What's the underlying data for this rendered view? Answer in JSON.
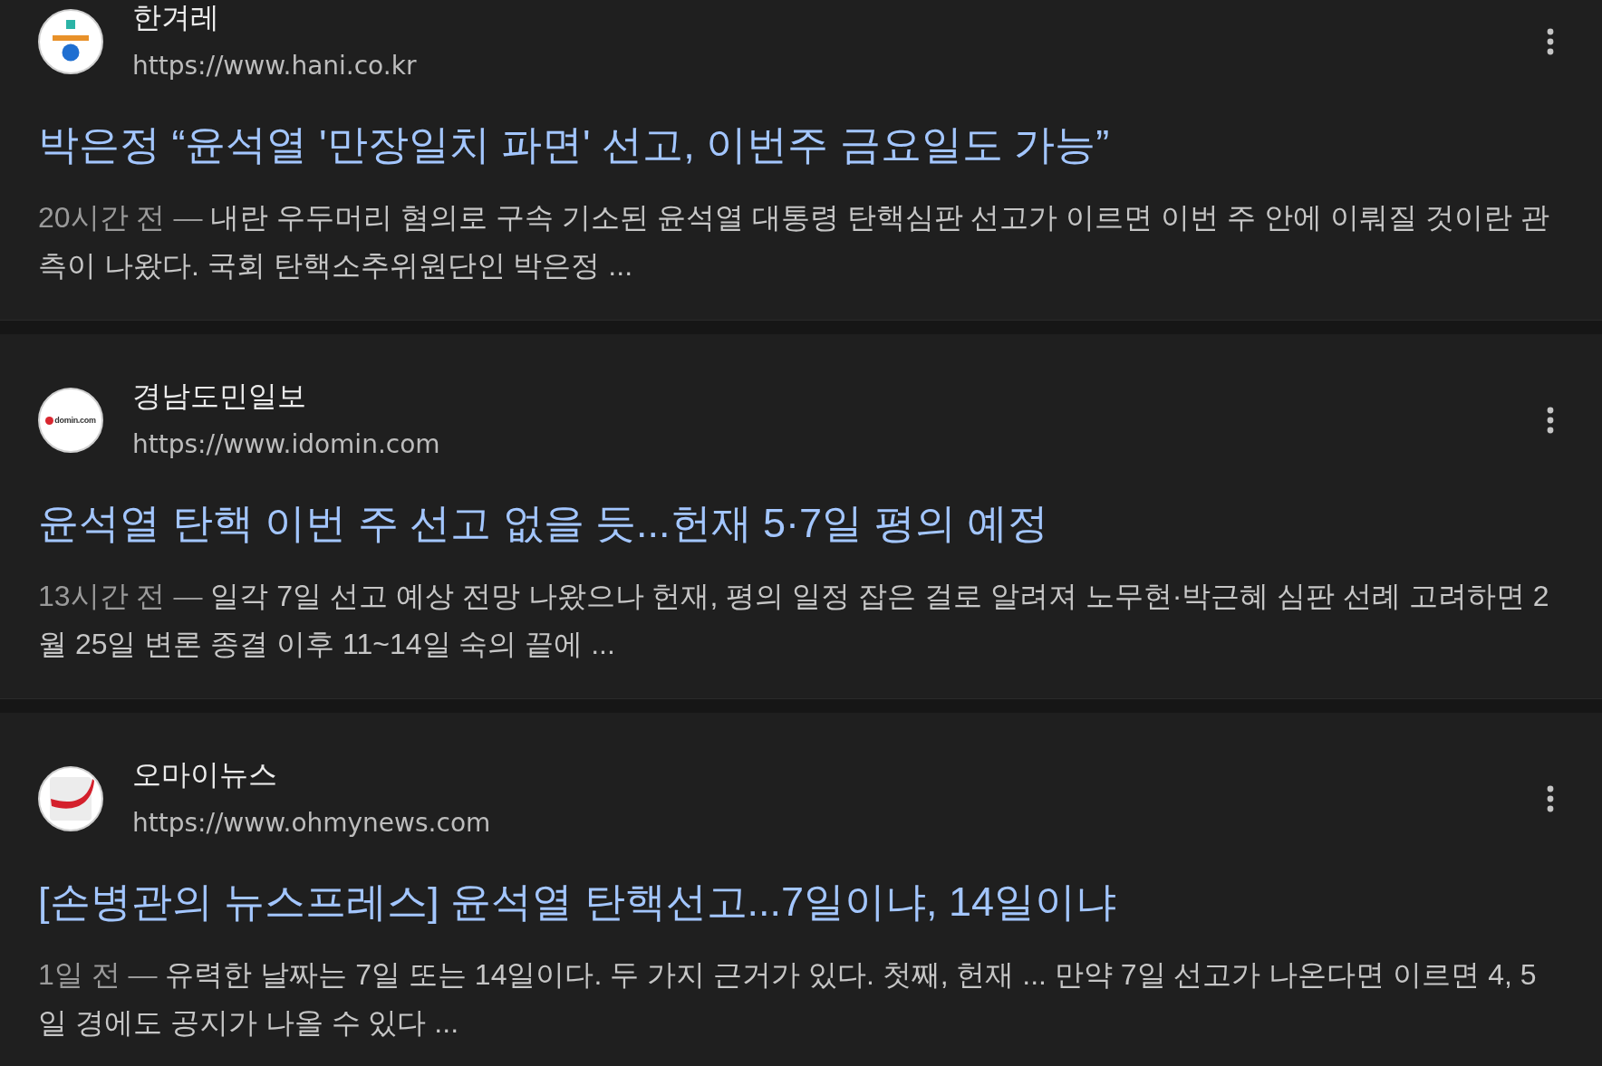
{
  "results": [
    {
      "logo": {
        "kind": "bar-dot"
      },
      "source": "한겨레",
      "url": "https://www.hani.co.kr",
      "title": "박은정 “윤석열 '만장일치 파면' 선고, 이번주 금요일도 가능”",
      "date": "20시간 전 —",
      "snippet": "내란 우두머리 혐의로 구속 기소된 윤석열 대통령 탄핵심판 선고가 이르면 이번 주 안에 이뤄질 것이란 관측이 나왔다. 국회 탄핵소추위원단인 박은정 ..."
    },
    {
      "logo": {
        "kind": "wordmark",
        "text": "domin.com"
      },
      "source": "경남도민일보",
      "url": "https://www.idomin.com",
      "title": "윤석열 탄핵 이번 주 선고 없을 듯...헌재 5·7일 평의 예정",
      "date": "13시간 전 —",
      "snippet": "일각 7일 선고 예상 전망 나왔으나 헌재, 평의 일정 잡은 걸로 알려져 노무현·박근혜 심판 선례 고려하면 2월 25일 변론 종결 이후 11~14일 숙의 끝에 ..."
    },
    {
      "logo": {
        "kind": "swoosh"
      },
      "source": "오마이뉴스",
      "url": "https://www.ohmynews.com",
      "title": "[손병관의 뉴스프레스] 윤석열 탄핵선고...7일이냐, 14일이냐",
      "date": "1일 전 —",
      "snippet": "유력한 날짜는 7일 또는 14일이다. 두 가지 근거가 있다. 첫째, 헌재 ... 만약 7일 선고가 나온다면 이르면 4, 5일 경에도 공지가 나올 수 있다 ..."
    }
  ]
}
